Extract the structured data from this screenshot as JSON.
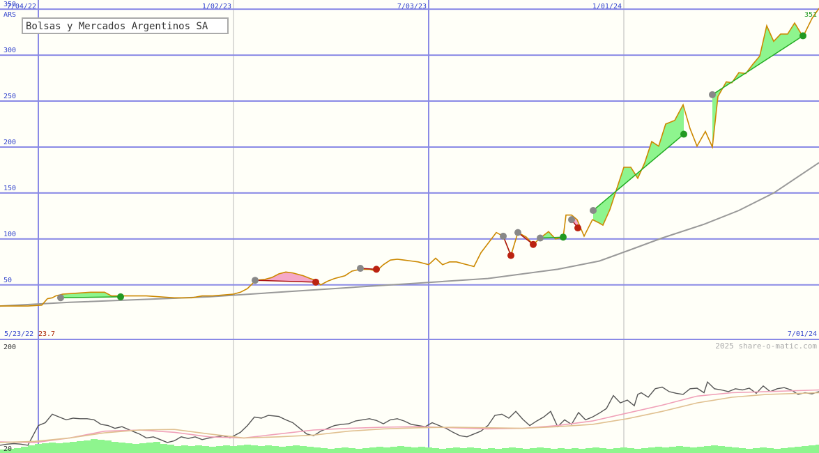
{
  "title": "Bolsas y Mercados Argentinos SA",
  "currency": "ARS",
  "last_price": "351",
  "start_date": "5/23/22",
  "start_price": "23.7",
  "end_date": "7/01/24",
  "watermark": "2025 share-o-matic.com",
  "colors": {
    "background": "#fffff8",
    "grid_major": "#8a8ae6",
    "grid_minor": "#b8b8b8",
    "axis_text": "#3344cc",
    "price_line": "#cc8800",
    "ma_line": "#999999",
    "gain_fill": "#8ef58e",
    "loss_fill": "#f5a8c8",
    "gain_dot": "#229922",
    "loss_dot": "#bb2211",
    "entry_dot": "#888888",
    "gain_trend": "#22aa22",
    "loss_trend": "#aa1111",
    "osc_line": "#555555",
    "osc_pink": "#f0a0b8",
    "osc_tan": "#e0c090",
    "volume": "#8ef58e",
    "last_price_color": "#229922",
    "start_price_color": "#aa2200"
  },
  "chart_data": [
    {
      "type": "line",
      "name": "price",
      "title": "Bolsas y Mercados Argentinos SA",
      "ylabel": "ARS",
      "ylim": [
        -4,
        360
      ],
      "y_ticks": [
        50,
        100,
        150,
        200,
        250,
        300,
        350
      ],
      "x_ticks": [
        "7/04/22",
        "1/02/23",
        "7/03/23",
        "1/01/24"
      ],
      "grid": true,
      "x_domain": [
        0,
        1175
      ],
      "x": [
        0,
        20,
        40,
        60,
        68,
        75,
        80,
        90,
        110,
        130,
        150,
        160,
        175,
        190,
        210,
        230,
        250,
        260,
        275,
        290,
        305,
        320,
        335,
        345,
        355,
        367,
        380,
        390,
        400,
        410,
        420,
        435,
        445,
        453,
        460,
        470,
        480,
        495,
        505,
        517,
        530,
        540,
        550,
        560,
        570,
        580,
        590,
        600,
        615,
        625,
        635,
        645,
        655,
        665,
        680,
        690,
        700,
        712,
        722,
        733,
        743,
        755,
        765,
        775,
        787,
        797,
        808,
        812,
        820,
        828,
        838,
        850,
        858,
        865,
        875,
        895,
        905,
        915,
        925,
        935,
        945,
        955,
        968,
        980,
        990,
        1000,
        1012,
        1022,
        1030,
        1042,
        1050,
        1060,
        1070,
        1080,
        1090,
        1100,
        1110,
        1120,
        1130,
        1140,
        1152,
        1165,
        1175
      ],
      "y": [
        27,
        27,
        27,
        28,
        35,
        36,
        38,
        40,
        41,
        42,
        42,
        38,
        38,
        38,
        38,
        37,
        36,
        36,
        36,
        38,
        38,
        39,
        40,
        42,
        46,
        55,
        56,
        58,
        62,
        64,
        63,
        60,
        57,
        55,
        50,
        54,
        57,
        60,
        65,
        67,
        67,
        65,
        72,
        77,
        78,
        77,
        76,
        75,
        72,
        79,
        72,
        75,
        75,
        73,
        70,
        85,
        95,
        107,
        103,
        82,
        107,
        102,
        94,
        101,
        108,
        100,
        102,
        126,
        126,
        121,
        103,
        121,
        118,
        115,
        132,
        178,
        178,
        166,
        183,
        206,
        201,
        225,
        229,
        246,
        220,
        201,
        217,
        200,
        255,
        271,
        270,
        281,
        280,
        290,
        299,
        332,
        315,
        323,
        323,
        335,
        320,
        340,
        351
      ],
      "moving_average": {
        "x": [
          0,
          100,
          200,
          300,
          400,
          500,
          600,
          700,
          800,
          860,
          900,
          950,
          1010,
          1060,
          1110,
          1175
        ],
        "y": [
          27,
          31,
          34,
          37,
          42,
          47,
          52,
          57,
          67,
          76,
          87,
          101,
          116,
          131,
          150,
          183
        ]
      },
      "trades": [
        {
          "x_start": 87,
          "x_end": 173,
          "y_start": 36,
          "y_end": 37,
          "result": "gain"
        },
        {
          "x_start": 366,
          "x_end": 453,
          "y_start": 55,
          "y_end": 53,
          "result": "loss"
        },
        {
          "x_start": 517,
          "x_end": 540,
          "y_start": 68,
          "y_end": 67,
          "result": "loss"
        },
        {
          "x_start": 722,
          "x_end": 733,
          "y_start": 103,
          "y_end": 82,
          "result": "loss"
        },
        {
          "x_start": 743,
          "x_end": 765,
          "y_start": 107,
          "y_end": 94,
          "result": "loss"
        },
        {
          "x_start": 775,
          "x_end": 808,
          "y_start": 101,
          "y_end": 102,
          "result": "gain"
        },
        {
          "x_start": 820,
          "x_end": 829,
          "y_start": 121,
          "y_end": 112,
          "result": "loss"
        },
        {
          "x_start": 851,
          "x_end": 981,
          "y_start": 131,
          "y_end": 214,
          "result": "gain"
        },
        {
          "x_start": 1022,
          "x_end": 1152,
          "y_start": 257,
          "y_end": 321,
          "result": "gain"
        }
      ]
    },
    {
      "type": "line",
      "name": "oscillator",
      "ylim": [
        20,
        200
      ],
      "y_ticks": [
        20,
        200
      ],
      "x_domain": [
        0,
        1175
      ],
      "series": [
        {
          "role": "main",
          "x": [
            0,
            10,
            20,
            30,
            40,
            55,
            65,
            75,
            85,
            95,
            105,
            115,
            125,
            135,
            145,
            155,
            165,
            175,
            190,
            200,
            210,
            220,
            230,
            240,
            250,
            260,
            270,
            280,
            290,
            300,
            310,
            320,
            330,
            345,
            355,
            365,
            375,
            385,
            400,
            410,
            420,
            430,
            440,
            450,
            460,
            470,
            480,
            490,
            500,
            510,
            520,
            530,
            540,
            550,
            560,
            570,
            580,
            590,
            600,
            610,
            620,
            630,
            640,
            650,
            660,
            670,
            680,
            690,
            700,
            710,
            720,
            730,
            740,
            750,
            760,
            770,
            780,
            790,
            800,
            810,
            820,
            830,
            840,
            850,
            860,
            870,
            880,
            890,
            900,
            910,
            915,
            920,
            930,
            940,
            950,
            960,
            970,
            980,
            990,
            1000,
            1010,
            1015,
            1025,
            1035,
            1045,
            1055,
            1065,
            1075,
            1085,
            1095,
            1105,
            1115,
            1125,
            1135,
            1145,
            1155,
            1165,
            1175
          ],
          "y": [
            25,
            27,
            28,
            27,
            25,
            60,
            65,
            80,
            75,
            70,
            73,
            72,
            72,
            70,
            62,
            60,
            55,
            58,
            50,
            45,
            38,
            40,
            35,
            30,
            33,
            40,
            37,
            40,
            35,
            38,
            40,
            42,
            38,
            48,
            60,
            75,
            73,
            78,
            76,
            70,
            65,
            55,
            45,
            42,
            50,
            55,
            60,
            62,
            63,
            68,
            70,
            72,
            69,
            63,
            70,
            72,
            68,
            62,
            60,
            58,
            65,
            60,
            55,
            48,
            42,
            40,
            45,
            50,
            60,
            78,
            80,
            73,
            85,
            71,
            60,
            68,
            75,
            85,
            58,
            70,
            62,
            83,
            70,
            75,
            82,
            90,
            113,
            100,
            105,
            95,
            115,
            118,
            110,
            125,
            128,
            120,
            117,
            115,
            125,
            126,
            118,
            137,
            125,
            123,
            120,
            125,
            123,
            126,
            117,
            130,
            120,
            125,
            127,
            123,
            115,
            118,
            116,
            120
          ],
          "color_key": "osc_line"
        },
        {
          "role": "signal",
          "x": [
            0,
            50,
            100,
            150,
            200,
            250,
            300,
            350,
            400,
            450,
            500,
            550,
            600,
            650,
            700,
            750,
            800,
            850,
            900,
            950,
            1000,
            1050,
            1100,
            1175
          ],
          "y": [
            31,
            30,
            38,
            50,
            52,
            48,
            40,
            38,
            45,
            52,
            55,
            57,
            58,
            56,
            54,
            55,
            60,
            68,
            82,
            96,
            112,
            118,
            120,
            123
          ],
          "color_key": "osc_pink"
        },
        {
          "role": "signal",
          "x": [
            0,
            50,
            100,
            150,
            200,
            250,
            300,
            350,
            400,
            450,
            500,
            550,
            600,
            650,
            700,
            750,
            800,
            850,
            900,
            950,
            1000,
            1050,
            1100,
            1175
          ],
          "y": [
            30,
            32,
            38,
            47,
            52,
            53,
            45,
            38,
            40,
            43,
            50,
            54,
            56,
            57,
            56,
            55,
            58,
            62,
            72,
            85,
            100,
            110,
            115,
            118
          ],
          "color_key": "osc_tan"
        }
      ],
      "volume": {
        "x": [
          0,
          10,
          20,
          30,
          40,
          50,
          60,
          70,
          80,
          90,
          100,
          110,
          120,
          130,
          140,
          150,
          160,
          170,
          180,
          190,
          200,
          210,
          220,
          230,
          240,
          250,
          260,
          270,
          280,
          290,
          300,
          310,
          320,
          330,
          340,
          350,
          360,
          370,
          380,
          390,
          400,
          410,
          420,
          430,
          440,
          450,
          460,
          470,
          480,
          490,
          500,
          510,
          520,
          530,
          540,
          550,
          560,
          570,
          580,
          590,
          600,
          610,
          620,
          630,
          640,
          650,
          660,
          670,
          680,
          690,
          700,
          710,
          720,
          730,
          740,
          750,
          760,
          770,
          780,
          790,
          800,
          810,
          820,
          830,
          840,
          850,
          860,
          870,
          880,
          890,
          900,
          910,
          920,
          930,
          940,
          950,
          960,
          970,
          980,
          990,
          1000,
          1010,
          1020,
          1030,
          1040,
          1050,
          1060,
          1070,
          1080,
          1090,
          1100,
          1110,
          1120,
          1130,
          1140,
          1150,
          1160,
          1170
        ],
        "y": [
          5,
          6,
          7,
          9,
          11,
          13,
          14,
          15,
          14,
          15,
          16,
          17,
          18,
          20,
          19,
          18,
          16,
          15,
          14,
          13,
          14,
          15,
          16,
          13,
          12,
          10,
          11,
          10,
          11,
          10,
          9,
          10,
          11,
          10,
          11,
          12,
          11,
          10,
          11,
          10,
          9,
          10,
          11,
          10,
          9,
          8,
          7,
          6,
          7,
          8,
          7,
          6,
          7,
          8,
          9,
          8,
          9,
          10,
          9,
          8,
          9,
          8,
          7,
          6,
          7,
          8,
          7,
          8,
          7,
          6,
          7,
          6,
          7,
          8,
          7,
          6,
          7,
          8,
          7,
          6,
          7,
          6,
          7,
          6,
          7,
          8,
          7,
          6,
          7,
          8,
          7,
          6,
          7,
          8,
          9,
          8,
          9,
          10,
          9,
          8,
          9,
          10,
          11,
          10,
          9,
          8,
          7,
          6,
          7,
          8,
          7,
          6,
          7,
          8,
          9,
          10,
          11,
          12
        ]
      }
    }
  ]
}
